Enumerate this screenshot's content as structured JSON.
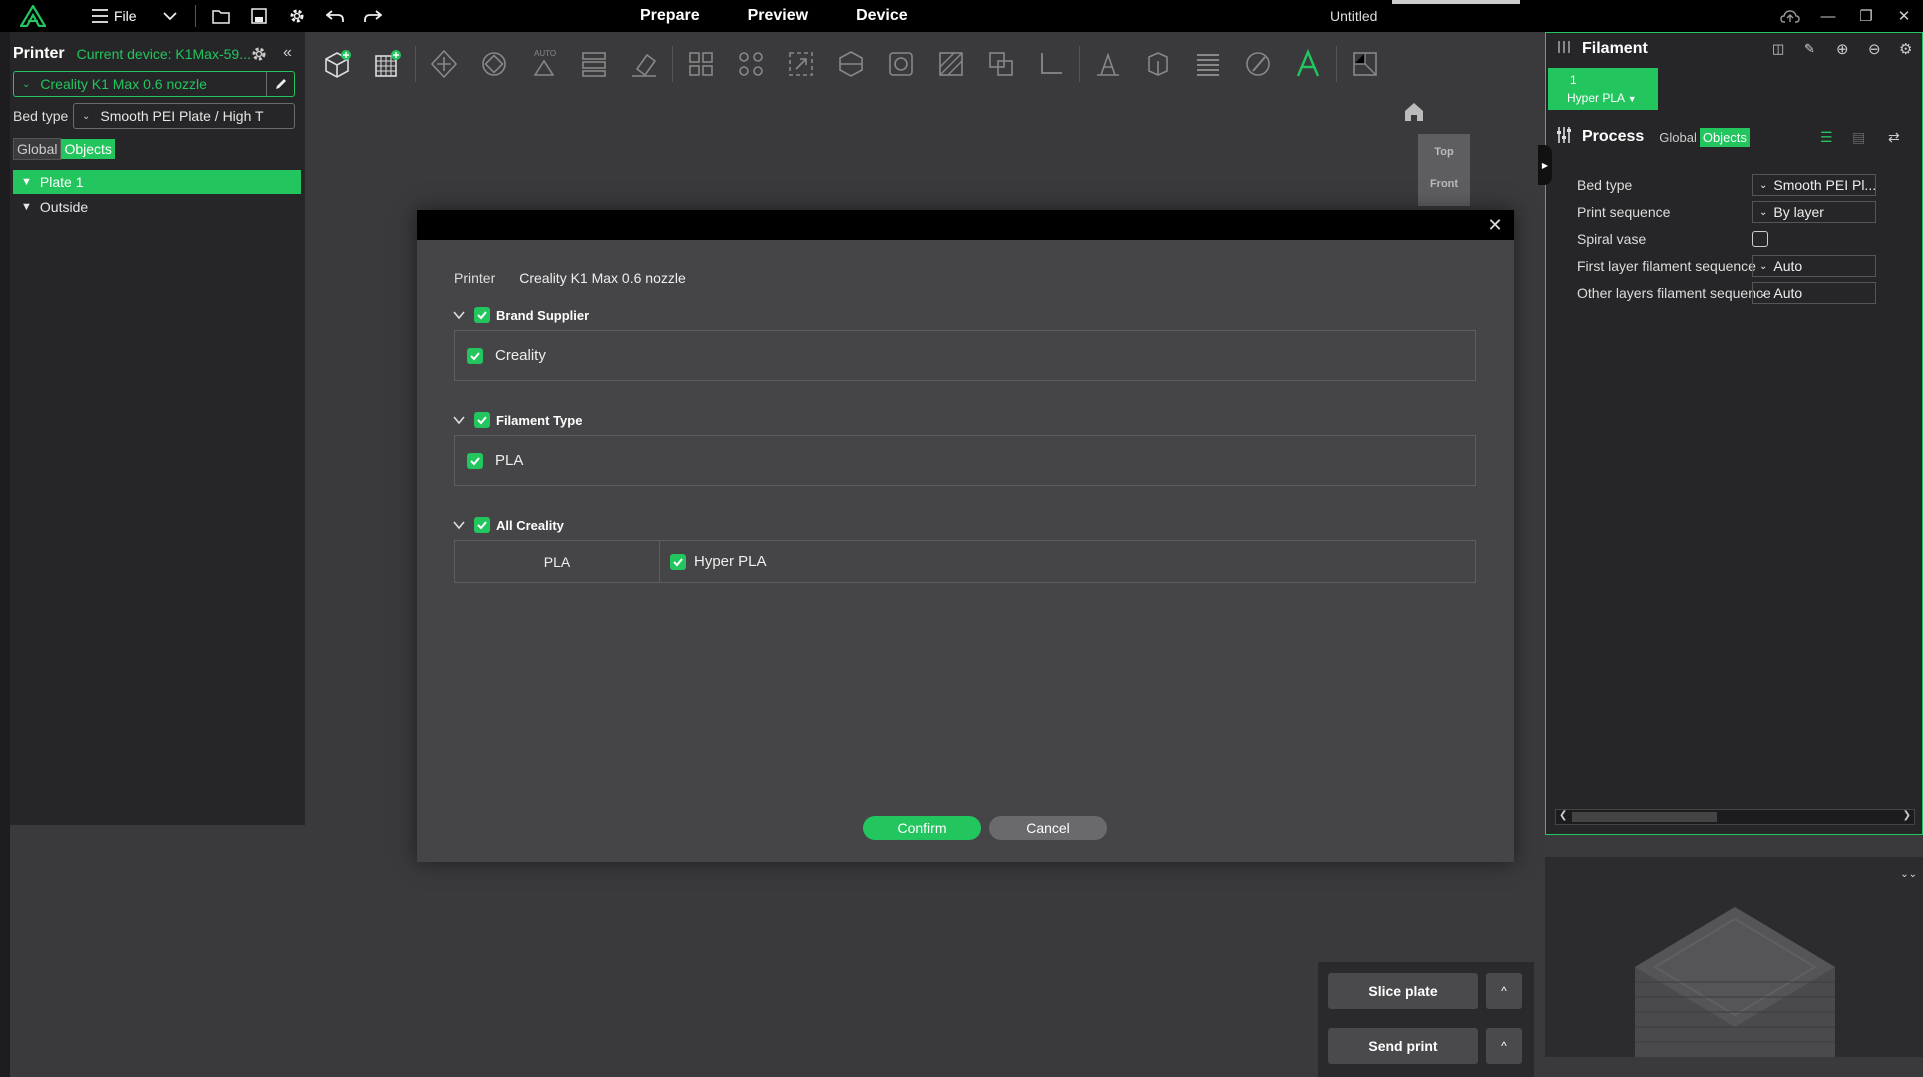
{
  "app": {
    "window_title": "Untitled",
    "menu_file": "File",
    "tabs": [
      "Prepare",
      "Preview",
      "Device"
    ],
    "accent": "#22c55e"
  },
  "left_panel": {
    "printer_title": "Printer",
    "current_device": "Current device: K1Max-59...",
    "printer_value": "Creality K1 Max 0.6 nozzle",
    "bed_type_label": "Bed type",
    "bed_type_value": "Smooth PEI Plate / High T",
    "tabs": [
      "Global",
      "Objects"
    ],
    "tree": [
      "Plate 1",
      "Outside"
    ]
  },
  "viewcube": {
    "top": "Top",
    "front": "Front"
  },
  "right_panel": {
    "filament_title": "Filament",
    "filament_chip_index": "1",
    "filament_chip_name": "Hyper PLA",
    "process_title": "Process",
    "tabs": [
      "Global",
      "Objects"
    ],
    "properties": [
      {
        "label": "Bed type",
        "value": "Smooth PEI Pl..."
      },
      {
        "label": "Print sequence",
        "value": "By layer"
      },
      {
        "label": "Spiral vase",
        "value": ""
      },
      {
        "label": "First layer filament sequence",
        "value": "Auto"
      },
      {
        "label": "Other layers filament sequence",
        "value": "Auto"
      }
    ]
  },
  "actions": {
    "slice_plate": "Slice plate",
    "send_print": "Send print",
    "caret": "^"
  },
  "dialog": {
    "printer_label": "Printer",
    "printer_value": "Creality K1 Max 0.6 nozzle",
    "sections": [
      {
        "title": "Brand Supplier",
        "items": [
          "Creality"
        ]
      },
      {
        "title": "Filament Type",
        "items": [
          "PLA"
        ]
      },
      {
        "title": "All Creality",
        "rows": [
          {
            "type": "PLA",
            "items": [
              "Hyper PLA"
            ]
          }
        ]
      }
    ],
    "confirm": "Confirm",
    "cancel": "Cancel"
  }
}
